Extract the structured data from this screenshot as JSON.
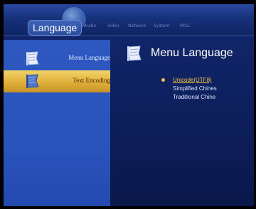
{
  "header": {
    "active_tab": "Language",
    "tabs": [
      "Audio",
      "Video",
      "Network",
      "System",
      "MISC"
    ]
  },
  "sidebar": {
    "items": [
      {
        "label": "Menu Language",
        "icon": "flag-icon",
        "selected": false
      },
      {
        "label": "Text Encoding",
        "icon": "flag-icon",
        "selected": true
      }
    ]
  },
  "content": {
    "title": "Menu Language",
    "icon": "flag-icon",
    "options": [
      "Unicode(UTF8)",
      "Simplified Chines",
      "Traditional Chine"
    ],
    "selected_option": "Unicode(UTF8)"
  },
  "colors": {
    "selection": "#e2b23c",
    "option_highlight": "#f0c24a",
    "background": "#12286e"
  }
}
